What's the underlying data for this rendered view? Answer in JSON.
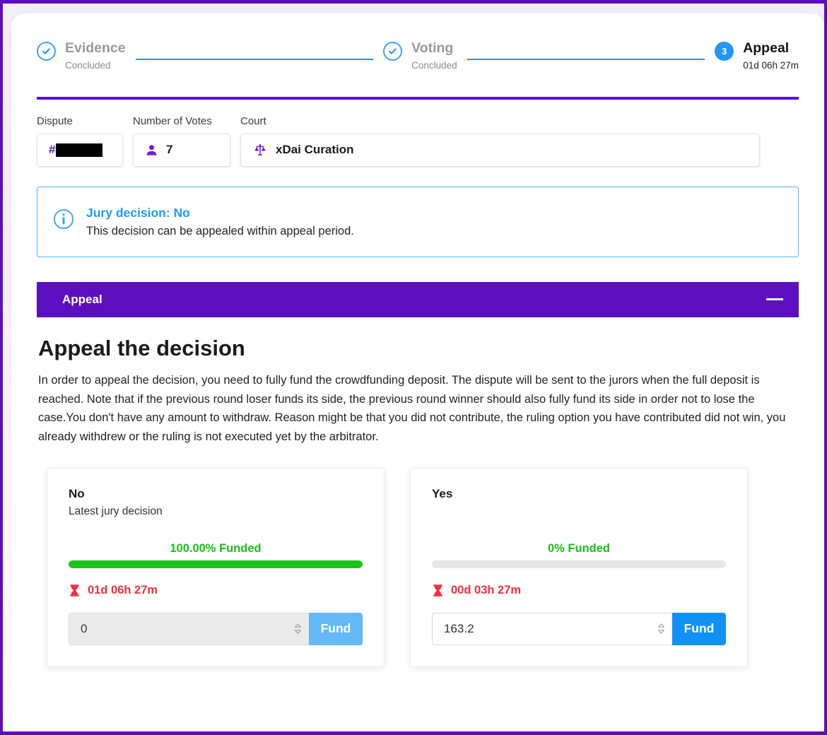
{
  "theme": {
    "brand_purple": "#5b0fbe",
    "accent_blue": "#1191f4",
    "info_blue": "#1f9cf0",
    "success_green": "#19c519",
    "danger_red": "#f22f3e"
  },
  "stepper": {
    "steps": [
      {
        "badge": "check-icon",
        "state": "done",
        "title": "Evidence",
        "subtitle": "Concluded"
      },
      {
        "badge": "check-icon",
        "state": "done",
        "title": "Voting",
        "subtitle": "Concluded"
      },
      {
        "badge": "3",
        "state": "active",
        "title": "Appeal",
        "subtitle": "01d 06h 27m"
      }
    ]
  },
  "meta": {
    "dispute": {
      "label": "Dispute",
      "prefix": "#",
      "value_redacted": true
    },
    "votes": {
      "label": "Number of Votes",
      "icon": "person-icon",
      "value": "7"
    },
    "court": {
      "label": "Court",
      "icon": "scales-icon",
      "value": "xDai Curation"
    }
  },
  "info_box": {
    "icon": "info-circle-icon",
    "title": "Jury decision: No",
    "body": "This decision can be appealed within appeal period."
  },
  "accordion": {
    "title": "Appeal",
    "toggle_icon": "minus-icon"
  },
  "panel": {
    "heading": "Appeal the decision",
    "paragraph": "In order to appeal the decision, you need to fully fund the crowdfunding deposit. The dispute will be sent to the jurors when the full deposit is reached. Note that if the previous round loser funds its side, the previous round winner should also fully fund its side in order not to lose the case.You don't have any amount to withdraw. Reason might be that you did not contribute, the ruling option you have contributed did not win, you already withdrew or the ruling is not executed yet by the arbitrator."
  },
  "fund_cards": [
    {
      "option": "No",
      "note": "Latest jury decision",
      "funded_label": "100.00% Funded",
      "funded_percent": 100,
      "timer_icon": "hourglass-icon",
      "timer": "01d 06h 27m",
      "input_value": "0",
      "input_disabled": true,
      "button_label": "Fund"
    },
    {
      "option": "Yes",
      "note": "",
      "funded_label": "0% Funded",
      "funded_percent": 0,
      "timer_icon": "hourglass-icon",
      "timer": "00d 03h 27m",
      "input_value": "163.2",
      "input_disabled": false,
      "button_label": "Fund"
    }
  ]
}
